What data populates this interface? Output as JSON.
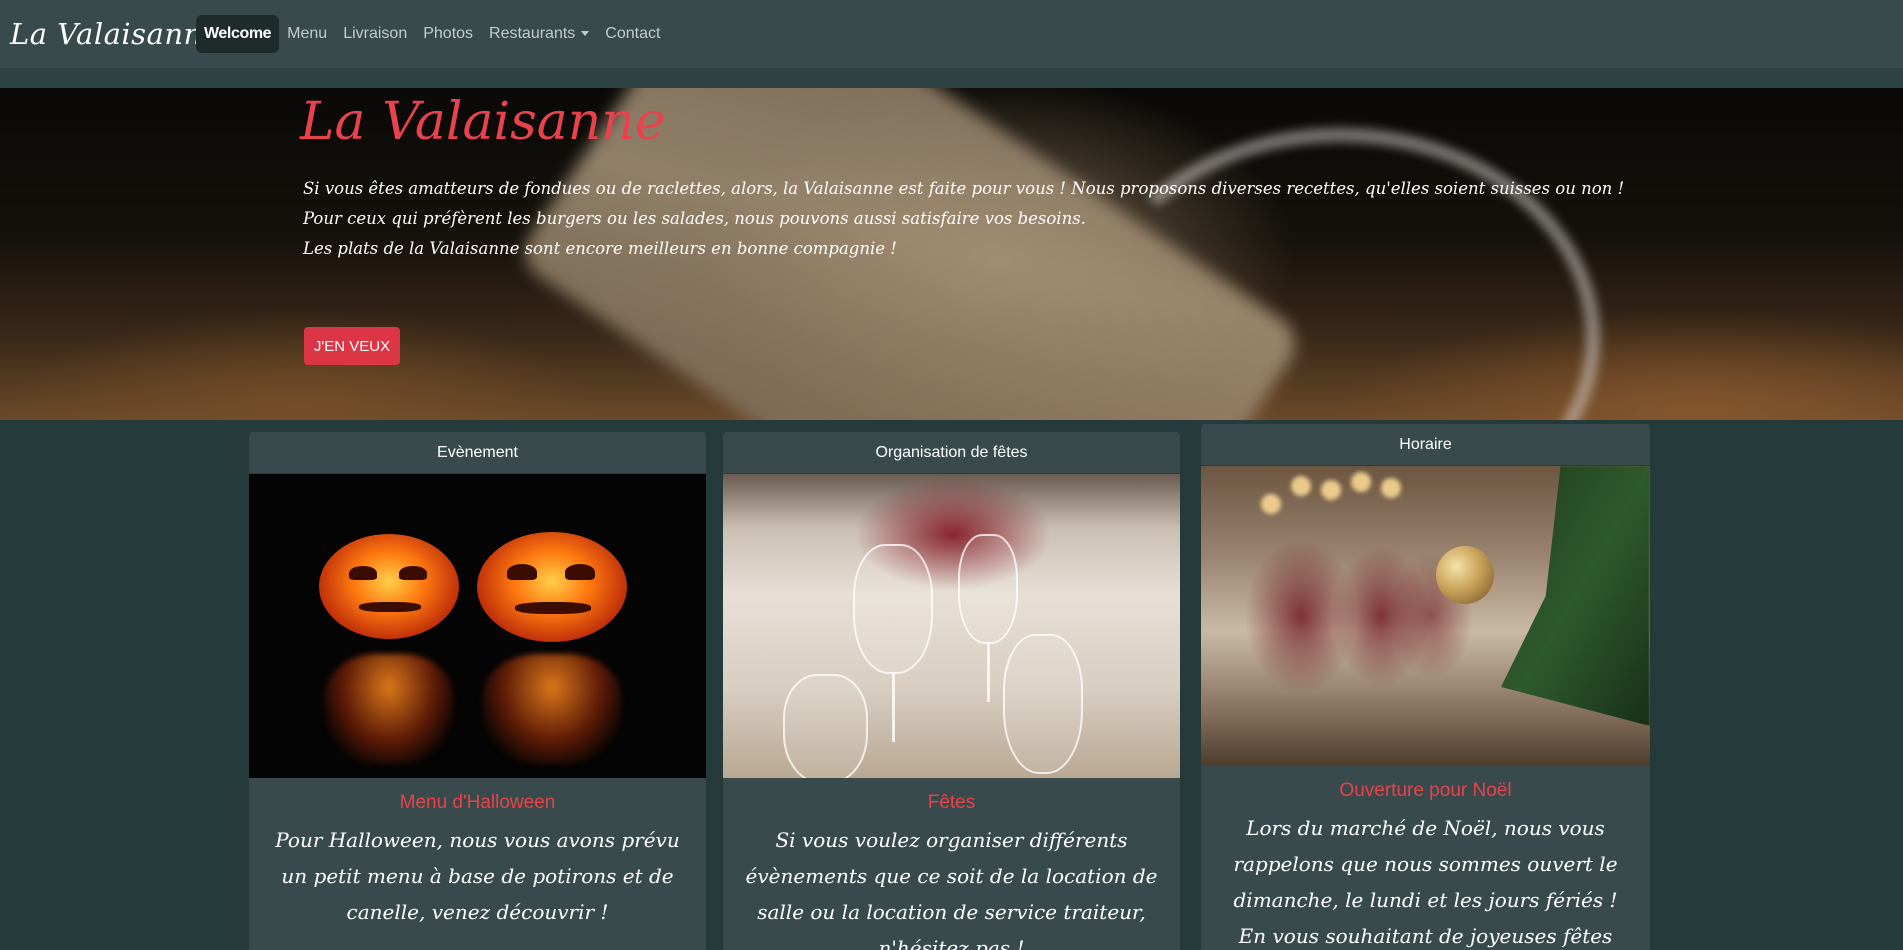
{
  "navbar": {
    "brand": "La Valaisanne",
    "items": [
      {
        "label": "Welcome",
        "active": true
      },
      {
        "label": "Menu"
      },
      {
        "label": "Livraison"
      },
      {
        "label": "Photos"
      },
      {
        "label": "Restaurants",
        "dropdown": true
      },
      {
        "label": "Contact"
      }
    ]
  },
  "hero": {
    "title": "La Valaisanne",
    "lines": [
      "Si vous êtes amatteurs de fondues ou de raclettes, alors, la Valaisanne est faite pour vous ! Nous proposons diverses recettes, qu'elles soient suisses ou non !",
      "Pour ceux qui préfèrent les burgers ou les salades, nous pouvons aussi satisfaire vos besoins.",
      "Les plats de la Valaisanne sont encore meilleurs en bonne compagnie !"
    ],
    "button": "J'EN VEUX"
  },
  "cards": [
    {
      "header": "Evènement",
      "title": "Menu d'Halloween",
      "text": "Pour Halloween, nous vous avons prévu un petit menu à base de potirons et de canelle, venez découvrir !",
      "image": "halloween-pumpkins"
    },
    {
      "header": "Organisation de fêtes",
      "title": "Fêtes",
      "text": "Si vous voulez organiser différents évènements que ce soit de la location de salle ou la location de service traiteur, n'hésitez pas !",
      "image": "banquet-table-glasses"
    },
    {
      "header": "Horaire",
      "title": "Ouverture pour Noël",
      "text": "Lors du marché de Noël, nous vous rappelons que nous sommes ouvert le dimanche, le lundi et les jours fériés ! En vous souhaitant de joyeuses fêtes d'avance.",
      "image": "christmas-tree-ornament"
    }
  ],
  "colors": {
    "background": "#243a3b",
    "navbar": "#384a4b",
    "accent": "#dc3545",
    "title_red": "#e8434c"
  }
}
